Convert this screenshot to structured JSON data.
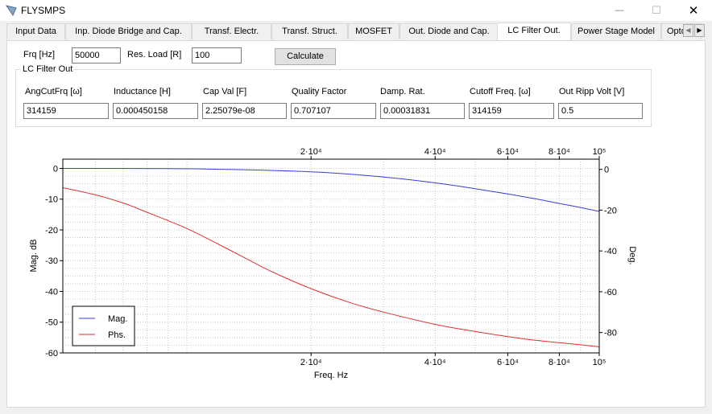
{
  "window": {
    "title": "FLYSMPS",
    "minimize": "—",
    "maximize": "☐",
    "close": "✕"
  },
  "tabs": [
    {
      "label": "Input Data"
    },
    {
      "label": "Inp. Diode Bridge and Cap."
    },
    {
      "label": "Transf. Electr."
    },
    {
      "label": "Transf. Struct."
    },
    {
      "label": "MOSFET"
    },
    {
      "label": "Out. Diode and Cap."
    },
    {
      "label": "LC Filter Out.",
      "active": true
    },
    {
      "label": "Power Stage Model"
    },
    {
      "label": "Opto"
    }
  ],
  "tab_scroll": {
    "left": "◀",
    "right": "▶"
  },
  "form": {
    "frq_label": "Frq [Hz]",
    "frq_value": "50000",
    "res_label": "Res. Load [R]",
    "res_value": "100",
    "calculate_label": "Calculate"
  },
  "lc_filter": {
    "title": "LC Filter Out",
    "fields": [
      {
        "label": "AngCutFrq [ω]",
        "value": "314159"
      },
      {
        "label": "Inductance [H]",
        "value": "0.000450158"
      },
      {
        "label": "Cap Val [F]",
        "value": "2.25079e-08"
      },
      {
        "label": "Quality Factor",
        "value": "0.707107"
      },
      {
        "label": "Damp. Rat.",
        "value": "0.00031831"
      },
      {
        "label": "Cutoff Freq. [ω]",
        "value": "314159"
      },
      {
        "label": "Out Ripp Volt [V]",
        "value": "0.5"
      }
    ]
  },
  "chart_data": {
    "type": "line",
    "xlabel": "Freq. Hz",
    "ylabel": "Mag. dB",
    "y2label": "Deg.",
    "xscale": "log",
    "xlim": [
      5000,
      100000
    ],
    "ylim": [
      -60,
      3
    ],
    "y2lim": [
      -90,
      5
    ],
    "xticks": [
      {
        "label": "2·10⁴",
        "value": 20000
      },
      {
        "label": "4·10⁴",
        "value": 40000
      },
      {
        "label": "6·10⁴",
        "value": 60000
      },
      {
        "label": "8·10⁴",
        "value": 80000
      },
      {
        "label": "10⁵",
        "value": 100000
      }
    ],
    "yticks": [
      0,
      -10,
      -20,
      -30,
      -40,
      -50,
      -60
    ],
    "y2ticks": [
      0,
      -20,
      -40,
      -60,
      -80
    ],
    "grid": true,
    "legend_position": "bottom-left",
    "series": [
      {
        "name": "Mag.",
        "color": "#3b3bd9",
        "axis": "left",
        "x": [
          5000,
          10000,
          20000,
          30000,
          40000,
          50000,
          60000,
          70000,
          80000,
          90000,
          100000
        ],
        "y": [
          0,
          -0.1,
          -1.1,
          -2.8,
          -4.7,
          -6.6,
          -8.3,
          -9.9,
          -11.4,
          -12.7,
          -14.0
        ]
      },
      {
        "name": "Phs.",
        "color": "#e03131",
        "axis": "right",
        "x": [
          5000,
          6000,
          7000,
          8000,
          10000,
          12000,
          14000,
          16000,
          20000,
          25000,
          30000,
          40000,
          50000,
          60000,
          70000,
          80000,
          90000,
          100000
        ],
        "y": [
          -9,
          -12.5,
          -16.5,
          -21,
          -29,
          -37,
          -44,
          -50,
          -58.5,
          -65.5,
          -70,
          -76,
          -79.5,
          -82,
          -83.8,
          -85,
          -86,
          -87
        ]
      }
    ]
  }
}
